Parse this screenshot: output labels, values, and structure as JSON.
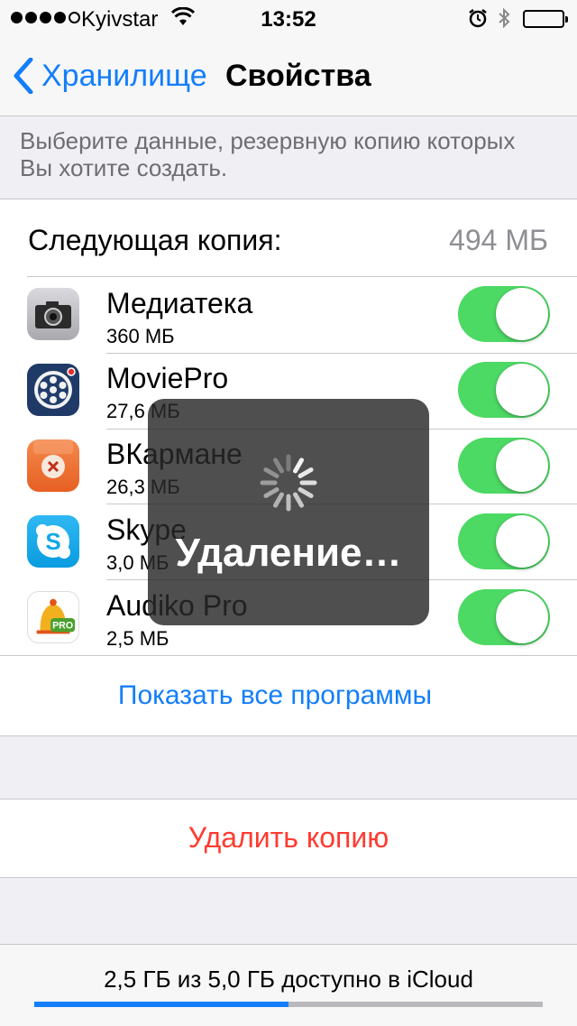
{
  "status_bar": {
    "carrier": "Kyivstar",
    "time": "13:52",
    "signal_bars_filled": 4,
    "signal_bars_total": 5
  },
  "nav": {
    "back_label": "Хранилище",
    "title": "Свойства"
  },
  "hint": "Выберите данные, резервную копию которых Вы хотите создать.",
  "next_backup": {
    "label": "Следующая копия:",
    "value": "494 МБ"
  },
  "apps": [
    {
      "name": "Медиатека",
      "size": "360 МБ",
      "icon": "camera-icon",
      "enabled": true
    },
    {
      "name": "MoviePro",
      "size": "27,6 МБ",
      "icon": "moviepro-icon",
      "enabled": true
    },
    {
      "name": "ВКармане",
      "size": "26,3 МБ",
      "icon": "vkarmane-icon",
      "enabled": true
    },
    {
      "name": "Skype",
      "size": "3,0 МБ",
      "icon": "skype-icon",
      "enabled": true
    },
    {
      "name": "Audiko Pro",
      "size": "2,5 МБ",
      "icon": "audiko-icon",
      "enabled": true
    }
  ],
  "show_all_label": "Показать все программы",
  "delete_label": "Удалить копию",
  "storage": {
    "text": "2,5 ГБ из 5,0 ГБ доступно в iCloud",
    "used_fraction": 0.5
  },
  "hud": {
    "text": "Удаление…"
  },
  "colors": {
    "accent": "#147efb",
    "toggle_on": "#4cd964",
    "destructive": "#ff3b30"
  }
}
